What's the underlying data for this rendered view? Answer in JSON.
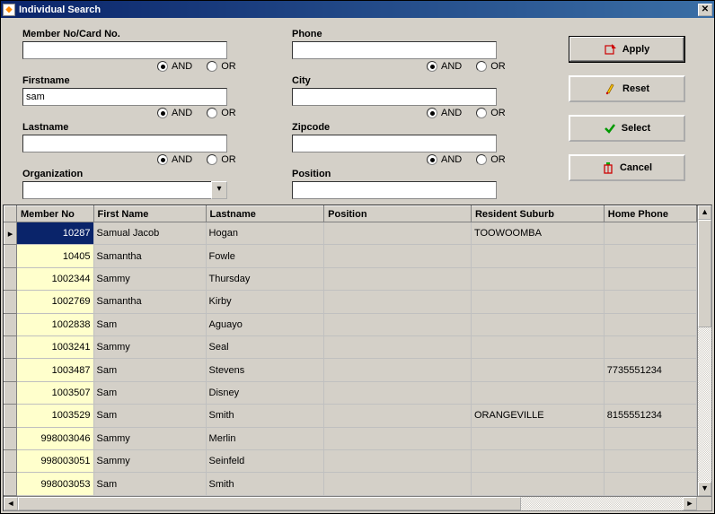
{
  "window": {
    "title": "Individual Search"
  },
  "fields": {
    "member_no": {
      "label": "Member No/Card No.",
      "value": "",
      "and": "AND",
      "or": "OR"
    },
    "firstname": {
      "label": "Firstname",
      "value": "sam",
      "and": "AND",
      "or": "OR"
    },
    "lastname": {
      "label": "Lastname",
      "value": "",
      "and": "AND",
      "or": "OR"
    },
    "organization": {
      "label": "Organization",
      "value": ""
    },
    "phone": {
      "label": "Phone",
      "value": "",
      "and": "AND",
      "or": "OR"
    },
    "city": {
      "label": "City",
      "value": "",
      "and": "AND",
      "or": "OR"
    },
    "zipcode": {
      "label": "Zipcode",
      "value": "",
      "and": "AND",
      "or": "OR"
    },
    "position": {
      "label": "Position",
      "value": ""
    }
  },
  "buttons": {
    "apply": "Apply",
    "reset": "Reset",
    "select": "Select",
    "cancel": "Cancel"
  },
  "grid": {
    "columns": [
      "Member No",
      "First Name",
      "Lastname",
      "Position",
      "Resident Suburb",
      "Home Phone"
    ],
    "rows": [
      {
        "member": "10287",
        "first": "Samual Jacob",
        "last": "Hogan",
        "pos": "",
        "suburb": "TOOWOOMBA",
        "phone": ""
      },
      {
        "member": "10405",
        "first": "Samantha",
        "last": "Fowle",
        "pos": "",
        "suburb": "",
        "phone": ""
      },
      {
        "member": "1002344",
        "first": "Sammy",
        "last": "Thursday",
        "pos": "",
        "suburb": "",
        "phone": ""
      },
      {
        "member": "1002769",
        "first": "Samantha",
        "last": "Kirby",
        "pos": "",
        "suburb": "",
        "phone": ""
      },
      {
        "member": "1002838",
        "first": "Sam",
        "last": "Aguayo",
        "pos": "",
        "suburb": "",
        "phone": ""
      },
      {
        "member": "1003241",
        "first": "Sammy",
        "last": "Seal",
        "pos": "",
        "suburb": "",
        "phone": ""
      },
      {
        "member": "1003487",
        "first": "Sam",
        "last": "Stevens",
        "pos": "",
        "suburb": "",
        "phone": "7735551234"
      },
      {
        "member": "1003507",
        "first": "Sam",
        "last": "Disney",
        "pos": "",
        "suburb": "",
        "phone": ""
      },
      {
        "member": "1003529",
        "first": "Sam",
        "last": "Smith",
        "pos": "",
        "suburb": "ORANGEVILLE",
        "phone": "8155551234"
      },
      {
        "member": "998003046",
        "first": "Sammy",
        "last": "Merlin",
        "pos": "",
        "suburb": "",
        "phone": ""
      },
      {
        "member": "998003051",
        "first": "Sammy",
        "last": "Seinfeld",
        "pos": "",
        "suburb": "",
        "phone": ""
      },
      {
        "member": "998003053",
        "first": "Sam",
        "last": "Smith",
        "pos": "",
        "suburb": "",
        "phone": ""
      }
    ],
    "selected_index": 0
  }
}
